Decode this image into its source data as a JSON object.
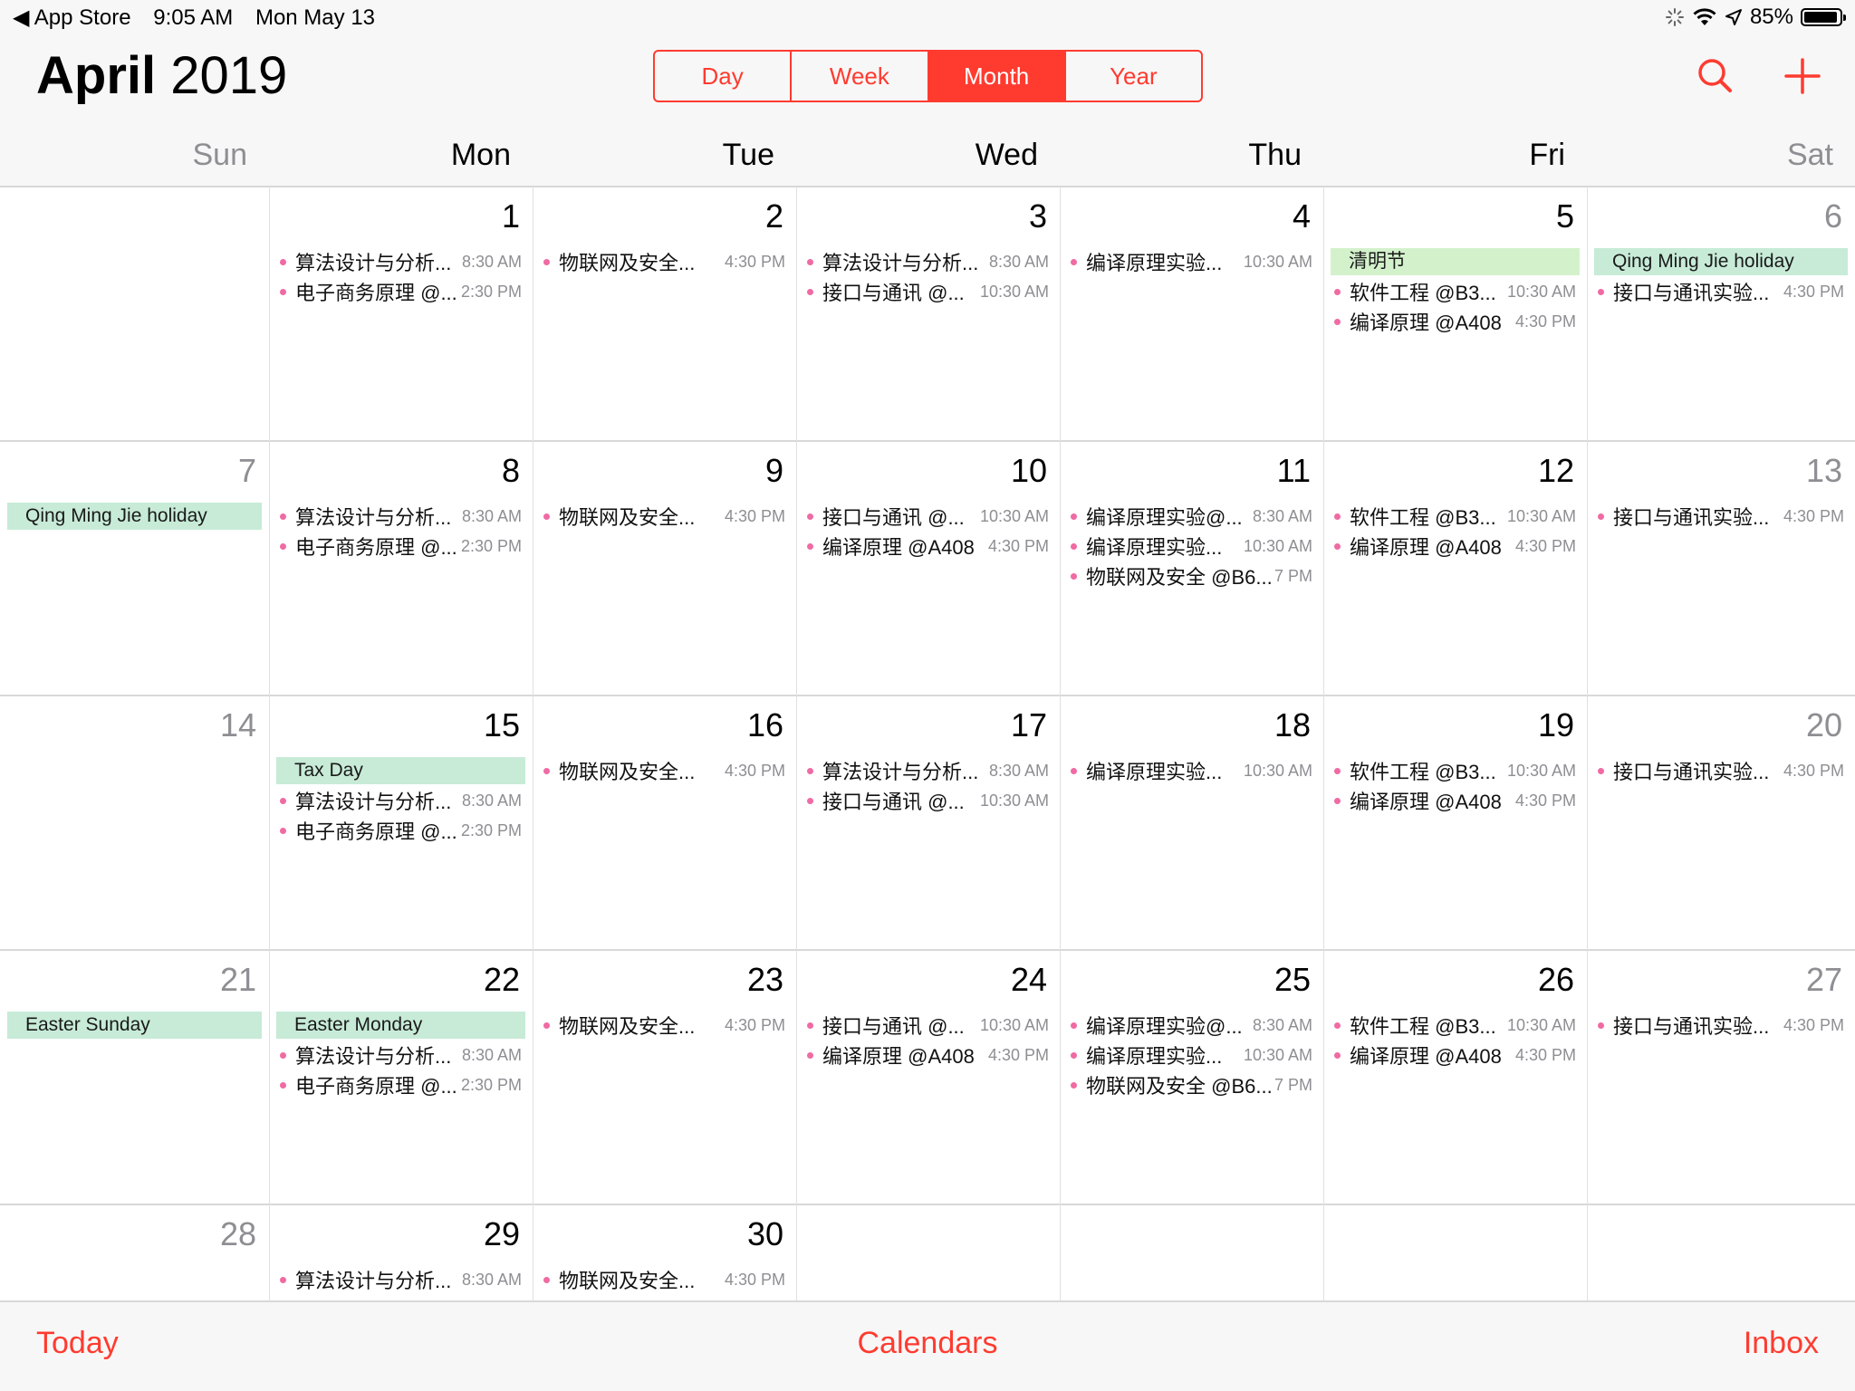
{
  "status_bar": {
    "back_label": "◀ App Store",
    "time": "9:05 AM",
    "date": "Mon May 13",
    "battery": "85%"
  },
  "header": {
    "month": "April",
    "year": "2019",
    "views": [
      "Day",
      "Week",
      "Month",
      "Year"
    ],
    "active_view": "Month"
  },
  "weekdays": [
    "Sun",
    "Mon",
    "Tue",
    "Wed",
    "Thu",
    "Fri",
    "Sat"
  ],
  "accent_color": "#ff3b30",
  "event_dot_color": "#f06aa3",
  "calendar": {
    "weeks": [
      [
        {
          "day": "",
          "allday": [],
          "events": []
        },
        {
          "day": "1",
          "allday": [],
          "events": [
            {
              "title": "算法设计与分析...",
              "time": "8:30 AM"
            },
            {
              "title": "电子商务原理 @...",
              "time": "2:30 PM"
            }
          ]
        },
        {
          "day": "2",
          "allday": [],
          "events": [
            {
              "title": "物联网及安全...",
              "time": "4:30 PM"
            }
          ]
        },
        {
          "day": "3",
          "allday": [],
          "events": [
            {
              "title": "算法设计与分析...",
              "time": "8:30 AM"
            },
            {
              "title": "接口与通讯 @...",
              "time": "10:30 AM"
            }
          ]
        },
        {
          "day": "4",
          "allday": [],
          "events": [
            {
              "title": "编译原理实验...",
              "time": "10:30 AM"
            }
          ]
        },
        {
          "day": "5",
          "allday": [
            {
              "title": "清明节",
              "kind": "jieqi"
            }
          ],
          "events": [
            {
              "title": "软件工程 @B3...",
              "time": "10:30 AM"
            },
            {
              "title": "编译原理 @A408",
              "time": "4:30 PM"
            }
          ]
        },
        {
          "day": "6",
          "allday": [
            {
              "title": "Qing Ming Jie holiday",
              "kind": "holiday"
            }
          ],
          "events": [
            {
              "title": "接口与通讯实验...",
              "time": "4:30 PM"
            }
          ]
        }
      ],
      [
        {
          "day": "7",
          "allday": [
            {
              "title": "Qing Ming Jie holiday",
              "kind": "holiday"
            }
          ],
          "events": []
        },
        {
          "day": "8",
          "allday": [],
          "events": [
            {
              "title": "算法设计与分析...",
              "time": "8:30 AM"
            },
            {
              "title": "电子商务原理 @...",
              "time": "2:30 PM"
            }
          ]
        },
        {
          "day": "9",
          "allday": [],
          "events": [
            {
              "title": "物联网及安全...",
              "time": "4:30 PM"
            }
          ]
        },
        {
          "day": "10",
          "allday": [],
          "events": [
            {
              "title": "接口与通讯 @...",
              "time": "10:30 AM"
            },
            {
              "title": "编译原理 @A408",
              "time": "4:30 PM"
            }
          ]
        },
        {
          "day": "11",
          "allday": [],
          "events": [
            {
              "title": "编译原理实验@...",
              "time": "8:30 AM"
            },
            {
              "title": "编译原理实验...",
              "time": "10:30 AM"
            },
            {
              "title": "物联网及安全 @B6...",
              "time": "7 PM"
            }
          ]
        },
        {
          "day": "12",
          "allday": [],
          "events": [
            {
              "title": "软件工程 @B3...",
              "time": "10:30 AM"
            },
            {
              "title": "编译原理 @A408",
              "time": "4:30 PM"
            }
          ]
        },
        {
          "day": "13",
          "allday": [],
          "events": [
            {
              "title": "接口与通讯实验...",
              "time": "4:30 PM"
            }
          ]
        }
      ],
      [
        {
          "day": "14",
          "allday": [],
          "events": []
        },
        {
          "day": "15",
          "allday": [
            {
              "title": "Tax Day",
              "kind": "holiday"
            }
          ],
          "events": [
            {
              "title": "算法设计与分析...",
              "time": "8:30 AM"
            },
            {
              "title": "电子商务原理 @...",
              "time": "2:30 PM"
            }
          ]
        },
        {
          "day": "16",
          "allday": [],
          "events": [
            {
              "title": "物联网及安全...",
              "time": "4:30 PM"
            }
          ]
        },
        {
          "day": "17",
          "allday": [],
          "events": [
            {
              "title": "算法设计与分析...",
              "time": "8:30 AM"
            },
            {
              "title": "接口与通讯 @...",
              "time": "10:30 AM"
            }
          ]
        },
        {
          "day": "18",
          "allday": [],
          "events": [
            {
              "title": "编译原理实验...",
              "time": "10:30 AM"
            }
          ]
        },
        {
          "day": "19",
          "allday": [],
          "events": [
            {
              "title": "软件工程 @B3...",
              "time": "10:30 AM"
            },
            {
              "title": "编译原理 @A408",
              "time": "4:30 PM"
            }
          ]
        },
        {
          "day": "20",
          "allday": [],
          "events": [
            {
              "title": "接口与通讯实验...",
              "time": "4:30 PM"
            }
          ]
        }
      ],
      [
        {
          "day": "21",
          "allday": [
            {
              "title": "Easter Sunday",
              "kind": "holiday"
            }
          ],
          "events": []
        },
        {
          "day": "22",
          "allday": [
            {
              "title": "Easter Monday",
              "kind": "holiday"
            }
          ],
          "events": [
            {
              "title": "算法设计与分析...",
              "time": "8:30 AM"
            },
            {
              "title": "电子商务原理 @...",
              "time": "2:30 PM"
            }
          ]
        },
        {
          "day": "23",
          "allday": [],
          "events": [
            {
              "title": "物联网及安全...",
              "time": "4:30 PM"
            }
          ]
        },
        {
          "day": "24",
          "allday": [],
          "events": [
            {
              "title": "接口与通讯 @...",
              "time": "10:30 AM"
            },
            {
              "title": "编译原理 @A408",
              "time": "4:30 PM"
            }
          ]
        },
        {
          "day": "25",
          "allday": [],
          "events": [
            {
              "title": "编译原理实验@...",
              "time": "8:30 AM"
            },
            {
              "title": "编译原理实验...",
              "time": "10:30 AM"
            },
            {
              "title": "物联网及安全 @B6...",
              "time": "7 PM"
            }
          ]
        },
        {
          "day": "26",
          "allday": [],
          "events": [
            {
              "title": "软件工程 @B3...",
              "time": "10:30 AM"
            },
            {
              "title": "编译原理 @A408",
              "time": "4:30 PM"
            }
          ]
        },
        {
          "day": "27",
          "allday": [],
          "events": [
            {
              "title": "接口与通讯实验...",
              "time": "4:30 PM"
            }
          ]
        }
      ],
      [
        {
          "day": "28",
          "allday": [],
          "events": []
        },
        {
          "day": "29",
          "allday": [],
          "events": [
            {
              "title": "算法设计与分析...",
              "time": "8:30 AM"
            }
          ]
        },
        {
          "day": "30",
          "allday": [],
          "events": [
            {
              "title": "物联网及安全...",
              "time": "4:30 PM"
            }
          ]
        },
        {
          "day": "",
          "allday": [],
          "events": []
        },
        {
          "day": "",
          "allday": [],
          "events": []
        },
        {
          "day": "",
          "allday": [],
          "events": []
        },
        {
          "day": "",
          "allday": [],
          "events": []
        }
      ]
    ]
  },
  "footer": {
    "today_label": "Today",
    "calendars_label": "Calendars",
    "inbox_label": "Inbox"
  }
}
